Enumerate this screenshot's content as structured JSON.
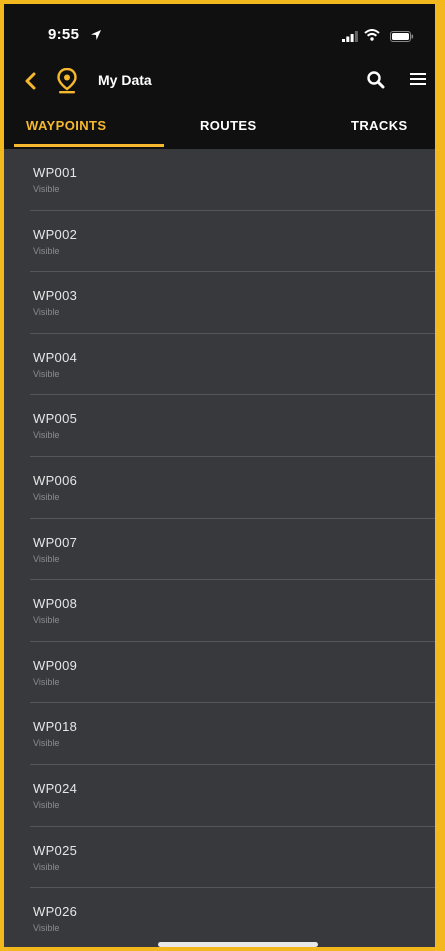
{
  "status_bar": {
    "time": "9:55"
  },
  "navbar": {
    "title": "My Data"
  },
  "tabs": [
    {
      "label": "WAYPOINTS",
      "active": true
    },
    {
      "label": "ROUTES",
      "active": false
    },
    {
      "label": "TRACKS",
      "active": false
    }
  ],
  "waypoints": [
    {
      "name": "WP001",
      "status": "Visible"
    },
    {
      "name": "WP002",
      "status": "Visible"
    },
    {
      "name": "WP003",
      "status": "Visible"
    },
    {
      "name": "WP004",
      "status": "Visible"
    },
    {
      "name": "WP005",
      "status": "Visible"
    },
    {
      "name": "WP006",
      "status": "Visible"
    },
    {
      "name": "WP007",
      "status": "Visible"
    },
    {
      "name": "WP008",
      "status": "Visible"
    },
    {
      "name": "WP009",
      "status": "Visible"
    },
    {
      "name": "WP018",
      "status": "Visible"
    },
    {
      "name": "WP024",
      "status": "Visible"
    },
    {
      "name": "WP025",
      "status": "Visible"
    },
    {
      "name": "WP026",
      "status": "Visible"
    }
  ],
  "colors": {
    "accent": "#f5b82e",
    "header_bg": "#101011",
    "list_bg": "#38393c",
    "frame": "#f3b81e"
  },
  "icons": [
    "location-arrow-icon",
    "signal-icon",
    "wifi-icon",
    "battery-icon",
    "back-chevron-icon",
    "map-pin-icon",
    "search-icon",
    "menu-icon"
  ]
}
